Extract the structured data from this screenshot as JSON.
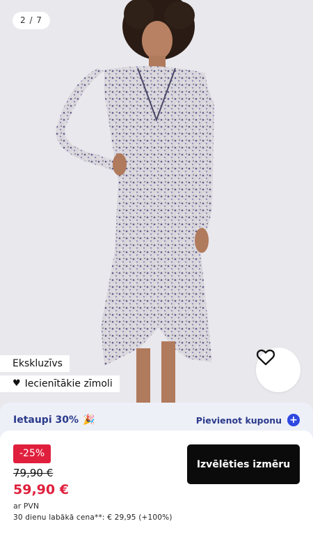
{
  "gallery": {
    "counter": "2 / 7"
  },
  "tags": {
    "exclusive": "Ekskluzīvs",
    "top_brands": "Iecienītākie zīmoli"
  },
  "icons": {
    "favorite": "heart-outline-icon",
    "brands_tag": "heart-filled-icon",
    "add_coupon": "plus-circle-icon",
    "party": "party-popper-icon"
  },
  "coupon": {
    "save_text": "Ietaupi 30%",
    "party_emoji": "🎉",
    "add_label": "Pievienot kuponu"
  },
  "price": {
    "discount": "-25%",
    "old": "79,90 €",
    "new": "59,90 €",
    "vat": "ar PVN",
    "lowest_30_days": "30 dienu labākā cena**: € 29,95 (+100%)"
  },
  "actions": {
    "choose_size": "Izvēlēties izmēru"
  },
  "colors": {
    "discount_red": "#e01f3d",
    "coupon_blue": "#2a3a8a",
    "plus_blue": "#2e48e0",
    "button_black": "#0b0b0b"
  }
}
